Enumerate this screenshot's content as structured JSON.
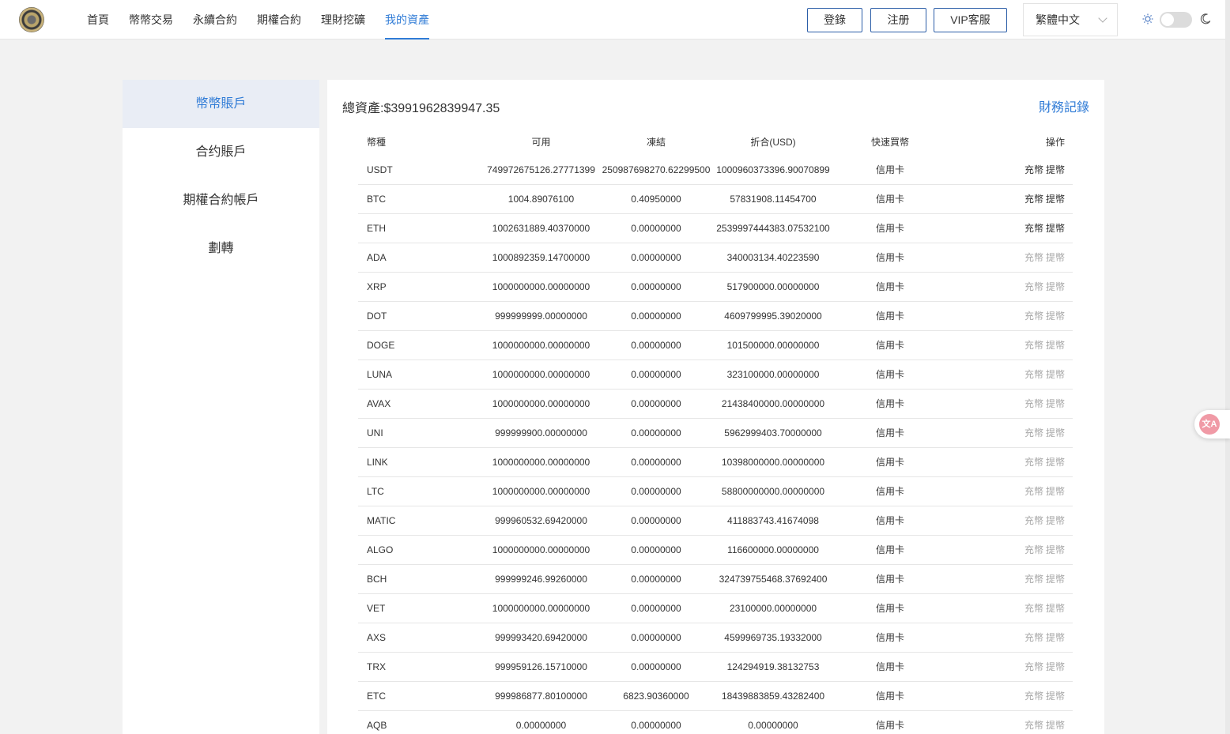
{
  "header": {
    "nav": [
      "首頁",
      "幣幣交易",
      "永續合約",
      "期權合約",
      "理財挖礦",
      "我的資產"
    ],
    "active_nav_index": 5,
    "login_label": "登錄",
    "register_label": "注册",
    "vip_label": "VIP客服",
    "language": "繁體中文",
    "theme": "light"
  },
  "sidebar": {
    "items": [
      {
        "label": "幣幣賬戶",
        "active": true
      },
      {
        "label": "合约賬戶",
        "active": false
      },
      {
        "label": "期權合約帳戶",
        "active": false
      },
      {
        "label": "劃轉",
        "active": false
      }
    ]
  },
  "main": {
    "total_assets": "總資產:$3991962839947.35",
    "finance_link": "財務記錄",
    "columns": [
      "幣種",
      "可用",
      "凍結",
      "折合(USD)",
      "快速買幣",
      "操作"
    ],
    "deposit_label": "充幣",
    "withdraw_label": "提幣",
    "rows": [
      {
        "coin": "USDT",
        "available": "749972675126.27771399",
        "frozen": "250987698270.62299500",
        "usd": "1000960373396.90070899",
        "buy": "信用卡",
        "ops_enabled": true
      },
      {
        "coin": "BTC",
        "available": "1004.89076100",
        "frozen": "0.40950000",
        "usd": "57831908.11454700",
        "buy": "信用卡",
        "ops_enabled": true
      },
      {
        "coin": "ETH",
        "available": "1002631889.40370000",
        "frozen": "0.00000000",
        "usd": "2539997444383.07532100",
        "buy": "信用卡",
        "ops_enabled": true
      },
      {
        "coin": "ADA",
        "available": "1000892359.14700000",
        "frozen": "0.00000000",
        "usd": "340003134.40223590",
        "buy": "信用卡",
        "ops_enabled": false
      },
      {
        "coin": "XRP",
        "available": "1000000000.00000000",
        "frozen": "0.00000000",
        "usd": "517900000.00000000",
        "buy": "信用卡",
        "ops_enabled": false
      },
      {
        "coin": "DOT",
        "available": "999999999.00000000",
        "frozen": "0.00000000",
        "usd": "4609799995.39020000",
        "buy": "信用卡",
        "ops_enabled": false
      },
      {
        "coin": "DOGE",
        "available": "1000000000.00000000",
        "frozen": "0.00000000",
        "usd": "101500000.00000000",
        "buy": "信用卡",
        "ops_enabled": false
      },
      {
        "coin": "LUNA",
        "available": "1000000000.00000000",
        "frozen": "0.00000000",
        "usd": "323100000.00000000",
        "buy": "信用卡",
        "ops_enabled": false
      },
      {
        "coin": "AVAX",
        "available": "1000000000.00000000",
        "frozen": "0.00000000",
        "usd": "21438400000.00000000",
        "buy": "信用卡",
        "ops_enabled": false
      },
      {
        "coin": "UNI",
        "available": "999999900.00000000",
        "frozen": "0.00000000",
        "usd": "5962999403.70000000",
        "buy": "信用卡",
        "ops_enabled": false
      },
      {
        "coin": "LINK",
        "available": "1000000000.00000000",
        "frozen": "0.00000000",
        "usd": "10398000000.00000000",
        "buy": "信用卡",
        "ops_enabled": false
      },
      {
        "coin": "LTC",
        "available": "1000000000.00000000",
        "frozen": "0.00000000",
        "usd": "58800000000.00000000",
        "buy": "信用卡",
        "ops_enabled": false
      },
      {
        "coin": "MATIC",
        "available": "999960532.69420000",
        "frozen": "0.00000000",
        "usd": "411883743.41674098",
        "buy": "信用卡",
        "ops_enabled": false
      },
      {
        "coin": "ALGO",
        "available": "1000000000.00000000",
        "frozen": "0.00000000",
        "usd": "116600000.00000000",
        "buy": "信用卡",
        "ops_enabled": false
      },
      {
        "coin": "BCH",
        "available": "999999246.99260000",
        "frozen": "0.00000000",
        "usd": "324739755468.37692400",
        "buy": "信用卡",
        "ops_enabled": false
      },
      {
        "coin": "VET",
        "available": "1000000000.00000000",
        "frozen": "0.00000000",
        "usd": "23100000.00000000",
        "buy": "信用卡",
        "ops_enabled": false
      },
      {
        "coin": "AXS",
        "available": "999993420.69420000",
        "frozen": "0.00000000",
        "usd": "4599969735.19332000",
        "buy": "信用卡",
        "ops_enabled": false
      },
      {
        "coin": "TRX",
        "available": "999959126.15710000",
        "frozen": "0.00000000",
        "usd": "124294919.38132753",
        "buy": "信用卡",
        "ops_enabled": false
      },
      {
        "coin": "ETC",
        "available": "999986877.80100000",
        "frozen": "6823.90360000",
        "usd": "18439883859.43282400",
        "buy": "信用卡",
        "ops_enabled": false
      },
      {
        "coin": "AQB",
        "available": "0.00000000",
        "frozen": "0.00000000",
        "usd": "0.00000000",
        "buy": "信用卡",
        "ops_enabled": false
      }
    ]
  },
  "colors": {
    "accent": "#2f7bd6",
    "button_border": "#2c5ea8",
    "dim_text": "#a8a8a8",
    "page_bg": "#f2f2f2"
  }
}
